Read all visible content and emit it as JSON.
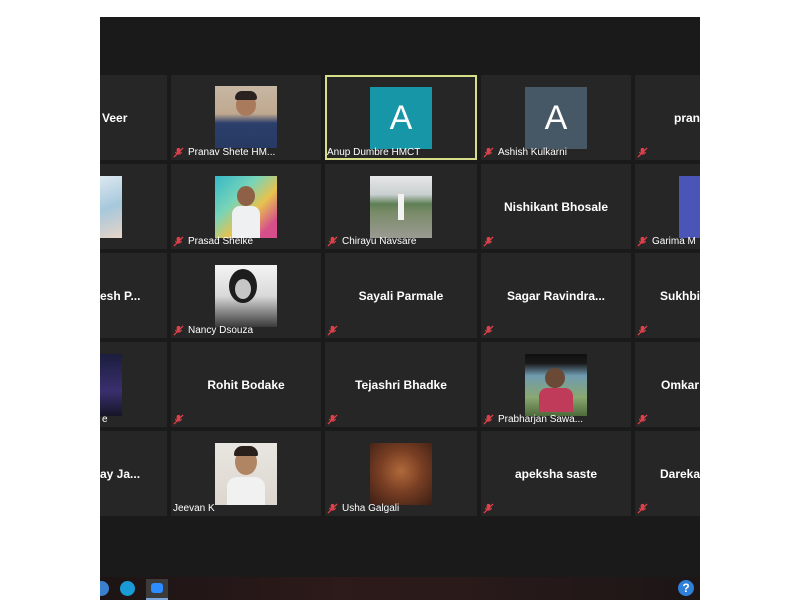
{
  "participants": {
    "veer": "Veer",
    "pranav": "Pranav Shete HM...",
    "anup": "Anup Dumbre HMCT",
    "anup_initial": "A",
    "ashish": "Ashish Kulkarni",
    "ashish_initial": "A",
    "pran_cut": "pran",
    "prasad": "Prasad Shelke",
    "chirayu": "Chirayu Navsare",
    "nishikant": "Nishikant Bhosale",
    "garima": "Garima M",
    "esh": "esh  P...",
    "nancy": "Nancy Dsouza",
    "sayali": "Sayali Parmale",
    "sagar": "Sagar  Ravindra...",
    "sukhbi": "Sukhbir",
    "row4_first": "e",
    "rohit": "Rohit Bodake",
    "tejashri": "Tejashri Bhadke",
    "prabharjan": "Prabharjan Sawa...",
    "omkar": "Omkar",
    "ay": "ay Ja...",
    "jeevan": "Jeevan K",
    "usha": "Usha Galgali",
    "apeksha": "apeksha saste",
    "darekar": "Darekar"
  },
  "colors": {
    "background": "#1a1a1a",
    "tile": "#262626",
    "active_border": "#d8dd8a",
    "avatar_teal": "#1696a6",
    "avatar_slate": "#465866",
    "mic_muted": "#e0404a"
  },
  "icons": {
    "mic": "mic-muted-icon",
    "help": "help-icon"
  },
  "taskbar": {
    "help_label": "?"
  }
}
